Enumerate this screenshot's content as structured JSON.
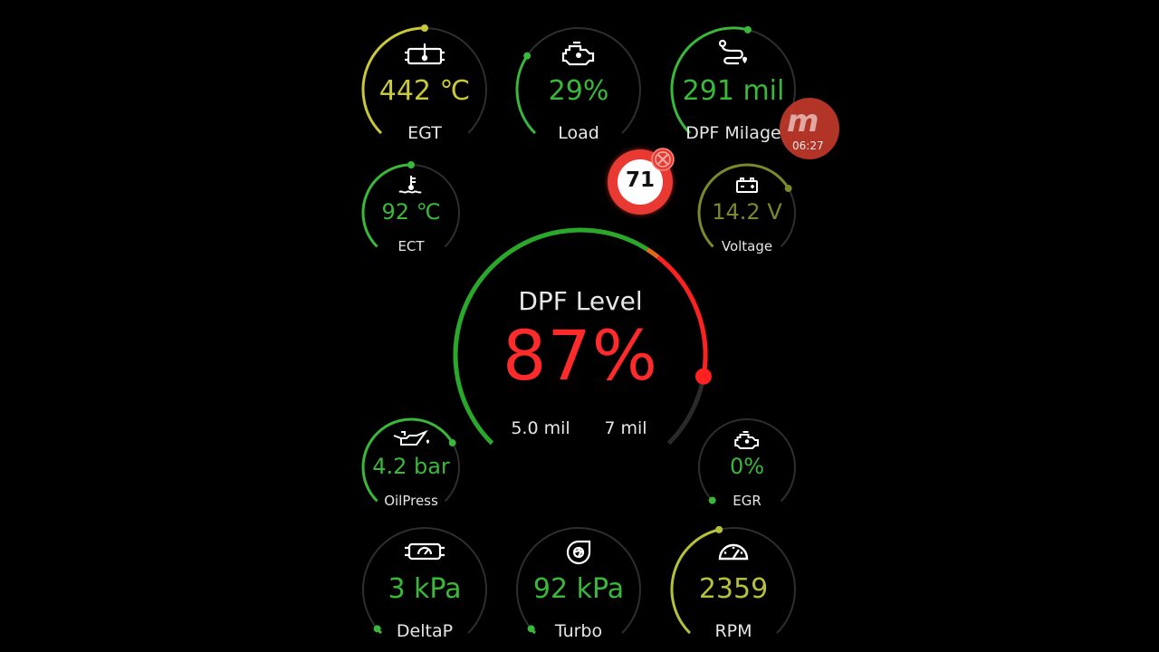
{
  "gauges": {
    "egt": {
      "value": "442 ℃",
      "label": "EGT",
      "color": "#c8c83a",
      "icon": "exhaust-temperature-icon",
      "level": 0.5
    },
    "load": {
      "value": "29%",
      "label": "Load",
      "color": "#3ab83a",
      "icon": "engine-icon",
      "level": 0.29
    },
    "dpf_milage": {
      "value": "291 mil",
      "label": "DPF Milage",
      "color": "#3ab83a",
      "icon": "route-icon",
      "level": 0.55
    },
    "ect": {
      "value": "92 ℃",
      "label": "ECT",
      "color": "#3ab83a",
      "icon": "coolant-temperature-icon",
      "level": 0.5
    },
    "voltage": {
      "value": "14.2 V",
      "label": "Voltage",
      "color": "#7a8a2a",
      "icon": "battery-icon",
      "level": 0.72
    },
    "oilpress": {
      "value": "4.2 bar",
      "label": "OilPress",
      "color": "#3ab83a",
      "icon": "oil-can-icon",
      "level": 0.72
    },
    "egr": {
      "value": "0%",
      "label": "EGR",
      "color": "#3ab83a",
      "icon": "engine-icon",
      "level": 0.0
    },
    "deltap": {
      "value": "3 kPa",
      "label": "DeltaP",
      "color": "#3ab83a",
      "icon": "pressure-gauge-icon",
      "level": 0.02
    },
    "turbo": {
      "value": "92 kPa",
      "label": "Turbo",
      "color": "#3ab83a",
      "icon": "turbo-icon",
      "level": 0.02
    },
    "rpm": {
      "value": "2359",
      "label": "RPM",
      "color": "#b5c13a",
      "icon": "speedometer-icon",
      "level": 0.45
    }
  },
  "dpf": {
    "title": "DPF Level",
    "value": "87%",
    "min_label": "5.0 mil",
    "max_label": "7 mil",
    "level": 0.87,
    "color_ok": "#2aa82a",
    "color_warn": "#e06a1a",
    "color_alert": "#ff2020"
  },
  "speed_limit": {
    "value": "71",
    "icon": "speed-limit-sign-icon",
    "close_icon": "close-icon"
  },
  "overlay": {
    "letter": "m",
    "time": "06:27"
  }
}
